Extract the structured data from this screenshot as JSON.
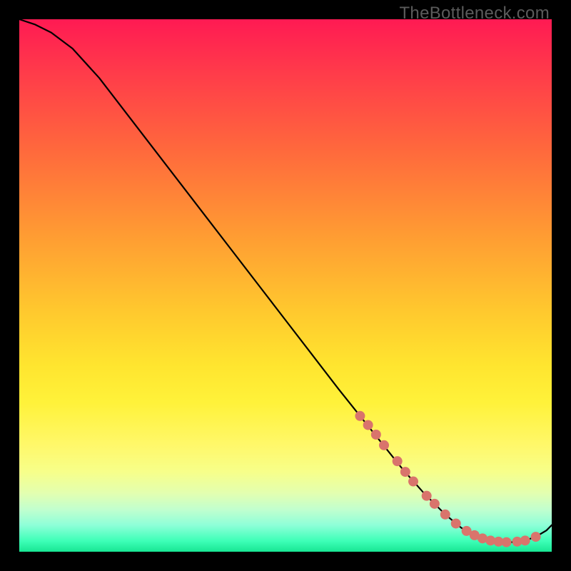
{
  "watermark": "TheBottleneck.com",
  "colors": {
    "curve": "#000000",
    "marker": "#d9746c",
    "background_top": "#ff1a53",
    "background_bottom": "#18e693",
    "page": "#000000"
  },
  "chart_data": {
    "type": "line",
    "title": "",
    "xlabel": "",
    "ylabel": "",
    "xlim": [
      0,
      100
    ],
    "ylim": [
      0,
      100
    ],
    "grid": false,
    "series": [
      {
        "name": "bottleneck-curve",
        "x": [
          0,
          3,
          6,
          10,
          15,
          20,
          25,
          30,
          35,
          40,
          45,
          50,
          55,
          60,
          64,
          68,
          72,
          76,
          80,
          83,
          85,
          87,
          89,
          91,
          93,
          95,
          97,
          99,
          100
        ],
        "y": [
          100,
          99,
          97.5,
          94.5,
          89,
          82.5,
          76,
          69.5,
          63,
          56.5,
          50,
          43.5,
          37,
          30.5,
          25.5,
          20.5,
          15.5,
          11,
          7,
          4.5,
          3.3,
          2.5,
          2,
          1.8,
          1.8,
          2.1,
          2.8,
          4,
          5
        ]
      }
    ],
    "markers": {
      "name": "highlighted-points",
      "series": "bottleneck-curve",
      "points": [
        {
          "x": 64,
          "y": 25.5
        },
        {
          "x": 65.5,
          "y": 23.8
        },
        {
          "x": 67,
          "y": 22
        },
        {
          "x": 68.5,
          "y": 20
        },
        {
          "x": 71,
          "y": 17
        },
        {
          "x": 72.5,
          "y": 15
        },
        {
          "x": 74,
          "y": 13.2
        },
        {
          "x": 76.5,
          "y": 10.5
        },
        {
          "x": 78,
          "y": 9
        },
        {
          "x": 80,
          "y": 7
        },
        {
          "x": 82,
          "y": 5.3
        },
        {
          "x": 84,
          "y": 3.9
        },
        {
          "x": 85.5,
          "y": 3.1
        },
        {
          "x": 87,
          "y": 2.5
        },
        {
          "x": 88.5,
          "y": 2.1
        },
        {
          "x": 90,
          "y": 1.9
        },
        {
          "x": 91.5,
          "y": 1.8
        },
        {
          "x": 93.5,
          "y": 1.9
        },
        {
          "x": 95,
          "y": 2.1
        },
        {
          "x": 97,
          "y": 2.8
        }
      ]
    }
  }
}
